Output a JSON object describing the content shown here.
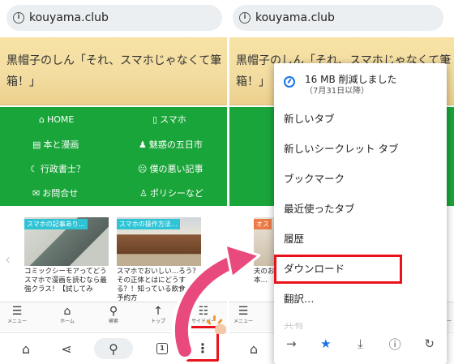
{
  "left": {
    "url": "kouyama.club",
    "banner_title": "黒帽子のしん「それ、スマホじゃなくて筆箱！」",
    "nav": [
      {
        "icon": "home-icon",
        "glyph": "⌂",
        "label": "HOME"
      },
      {
        "icon": "phone-icon",
        "glyph": "▯",
        "label": "スマホ"
      },
      {
        "icon": "document-icon",
        "glyph": "▤",
        "label": "本と漫画"
      },
      {
        "icon": "person-icon",
        "glyph": "♟",
        "label": "魅惑の五日市"
      },
      {
        "icon": "moon-icon",
        "glyph": "☾",
        "label": "行政書士？"
      },
      {
        "icon": "frown-icon",
        "glyph": "☹",
        "label": "僕の悪い記事"
      },
      {
        "icon": "mail-icon",
        "glyph": "✉",
        "label": "お問合せ"
      },
      {
        "icon": "person-icon",
        "glyph": "♙",
        "label": "ポリシーなど"
      }
    ],
    "cards": [
      {
        "tag": "スマホの記事あり…",
        "text": "コミックシーモアってどうスマホで漫画を読むなら最強クラス！【試してみ"
      },
      {
        "tag": "スマホの操作方法…",
        "text": "スマホでおいしい…ろう？その正体とはにどうする？！知っている飲食店の予約方"
      }
    ],
    "bottom_nav": [
      {
        "icon": "hamburger-icon",
        "glyph": "☰",
        "label": "メニュー"
      },
      {
        "icon": "home-icon",
        "glyph": "⌂",
        "label": "ホーム"
      },
      {
        "icon": "search-icon",
        "glyph": "⚲",
        "label": "検索"
      },
      {
        "icon": "arrow-up-icon",
        "glyph": "↑",
        "label": "トップ"
      },
      {
        "icon": "sidebar-icon",
        "glyph": "☷",
        "label": "サイドバー"
      }
    ],
    "chrome_bar": {
      "home": "⌂",
      "share": "⋖",
      "search": "⚲",
      "tab_count": "1",
      "menu": "⋮"
    }
  },
  "right": {
    "url": "kouyama.club",
    "banner_title": "黒帽子のしん「それ、スマホじゃなくて筆箱！」",
    "menu": {
      "header_title": "16 MB 削減しました",
      "header_sub": "（7月31日以降）",
      "items": [
        "新しいタブ",
        "新しいシークレット タブ",
        "ブックマーク",
        "最近使ったタブ",
        "履歴",
        "ダウンロード",
        "翻訳…",
        "共有"
      ],
      "icon_row": [
        {
          "icon": "forward-arrow-icon",
          "glyph": "→"
        },
        {
          "icon": "star-icon",
          "glyph": "★"
        },
        {
          "icon": "download-icon",
          "glyph": "⤓"
        },
        {
          "icon": "info-icon",
          "glyph": "ⓘ"
        },
        {
          "icon": "refresh-icon",
          "glyph": "↻"
        }
      ]
    },
    "card_tag": "オス",
    "card_text": "夫のお\n日本…",
    "bottom_labels": [
      "メニュー",
      "サイドバー"
    ],
    "chrome_bar": {
      "home": "⌂"
    }
  },
  "colors": {
    "green_nav": "#1aa53a",
    "highlight_red": "#e8121b",
    "arrow_pink": "#e94a7d",
    "accent_blue": "#1a73e8"
  }
}
